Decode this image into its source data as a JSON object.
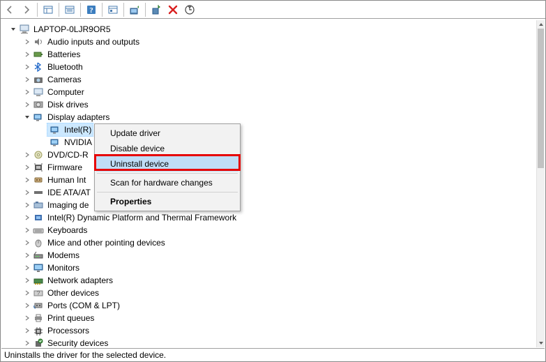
{
  "toolbar": {
    "back": "Back",
    "forward": "Forward",
    "show_hidden": "Show hidden devices",
    "view": "View",
    "help": "Help",
    "properties": "Properties",
    "update_driver": "Update driver",
    "uninstall": "Uninstall device",
    "cancel_x": "Cancel",
    "scan": "Scan for hardware changes"
  },
  "tree": {
    "root": {
      "label": "LAPTOP-0LJR9OR5",
      "expanded": true
    },
    "categories": [
      {
        "label": "Audio inputs and outputs",
        "expanded": false
      },
      {
        "label": "Batteries",
        "expanded": false
      },
      {
        "label": "Bluetooth",
        "expanded": false
      },
      {
        "label": "Cameras",
        "expanded": false
      },
      {
        "label": "Computer",
        "expanded": false
      },
      {
        "label": "Disk drives",
        "expanded": false
      },
      {
        "label": "Display adapters",
        "expanded": true,
        "children": [
          {
            "label": "Intel(R)",
            "selected": true
          },
          {
            "label": "NVIDIA"
          }
        ]
      },
      {
        "label": "DVD/CD-R",
        "expanded": false,
        "truncated": true
      },
      {
        "label": "Firmware",
        "expanded": false
      },
      {
        "label": "Human Int",
        "expanded": false,
        "truncated": true
      },
      {
        "label": "IDE ATA/AT",
        "expanded": false,
        "truncated": true
      },
      {
        "label": "Imaging de",
        "expanded": false,
        "truncated": true
      },
      {
        "label": "Intel(R) Dynamic Platform and Thermal Framework",
        "expanded": false
      },
      {
        "label": "Keyboards",
        "expanded": false
      },
      {
        "label": "Mice and other pointing devices",
        "expanded": false
      },
      {
        "label": "Modems",
        "expanded": false
      },
      {
        "label": "Monitors",
        "expanded": false
      },
      {
        "label": "Network adapters",
        "expanded": false
      },
      {
        "label": "Other devices",
        "expanded": false
      },
      {
        "label": "Ports (COM & LPT)",
        "expanded": false
      },
      {
        "label": "Print queues",
        "expanded": false
      },
      {
        "label": "Processors",
        "expanded": false
      },
      {
        "label": "Security devices",
        "expanded": false
      }
    ]
  },
  "context_menu": {
    "items": [
      {
        "label": "Update driver",
        "type": "item"
      },
      {
        "label": "Disable device",
        "type": "item"
      },
      {
        "label": "Uninstall device",
        "type": "item",
        "hover": true,
        "highlighted": true
      },
      {
        "type": "sep"
      },
      {
        "label": "Scan for hardware changes",
        "type": "item"
      },
      {
        "type": "sep"
      },
      {
        "label": "Properties",
        "type": "item",
        "bold": true
      }
    ]
  },
  "statusbar": {
    "text": "Uninstalls the driver for the selected device."
  },
  "colors": {
    "selection": "#cce8ff",
    "highlight_border": "#e60000",
    "menu_hover": "#c0ddf6"
  }
}
